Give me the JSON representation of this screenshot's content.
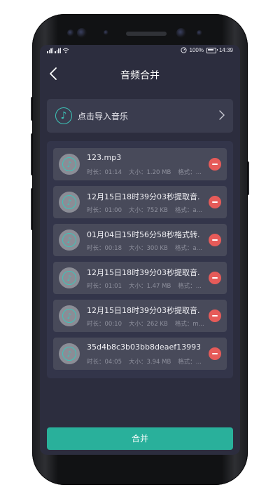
{
  "status": {
    "battery": "100%",
    "time": "14:39"
  },
  "header": {
    "title": "音频合并"
  },
  "import": {
    "label": "点击导入音乐"
  },
  "files": [
    {
      "name": "123.mp3",
      "duration_label": "时长：01:14",
      "size_label": "大小：1.20 MB",
      "format_label": "格式：..."
    },
    {
      "name": "12月15日18时39分03秒提取音...",
      "duration_label": "时长：01:00",
      "size_label": "大小：752 KB",
      "format_label": "格式：a..."
    },
    {
      "name": "01月04日15时56分58秒格式转...",
      "duration_label": "时长：00:18",
      "size_label": "大小：300 KB",
      "format_label": "格式：a..."
    },
    {
      "name": "12月15日18时39分03秒提取音...",
      "duration_label": "时长：01:01",
      "size_label": "大小：1.47 MB",
      "format_label": "格式：..."
    },
    {
      "name": "12月15日18时39分03秒提取音...",
      "duration_label": "时长：00:10",
      "size_label": "大小：262 KB",
      "format_label": "格式：m..."
    },
    {
      "name": "35d4b8c3b03bb8deaef13993b...",
      "duration_label": "时长：04:05",
      "size_label": "大小：3.94 MB",
      "format_label": "格式：..."
    }
  ],
  "actions": {
    "merge_label": "合并"
  },
  "colors": {
    "screen_bg": "#2c2d3e",
    "accent": "#29b09b",
    "delete": "#e65b59"
  }
}
